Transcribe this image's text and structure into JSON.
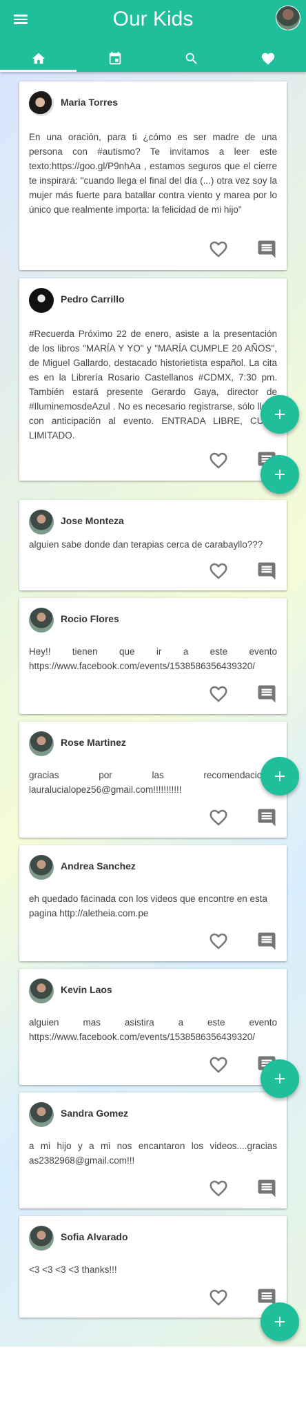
{
  "app": {
    "title": "Our Kids"
  },
  "tabs": [
    {
      "name": "home",
      "active": true
    },
    {
      "name": "calendar",
      "active": false
    },
    {
      "name": "search",
      "active": false
    },
    {
      "name": "favorites",
      "active": false
    }
  ],
  "posts": [
    {
      "author": "Maria Torres",
      "text": "En una oración, para ti ¿cómo es ser madre de una persona con #autismo? Te invitamos a leer este texto:https://goo.gl/P9nhAa , estamos seguros que el cierre te inspirará: \"cuando llega el final del día (...) otra vez soy la mujer más fuerte para batallar contra viento y marea por lo único que realmente importa: la felicidad de mi hijo\""
    },
    {
      "author": "Pedro Carrillo",
      "text": "#Recuerda Próximo 22 de enero, asiste a la presentación de los libros \"MARÍA Y YO\" y \"MARÍA CUMPLE 20 AÑOS\", de Miguel Gallardo, destacado historietista español. La cita es en la Librería Rosario Castellanos #CDMX, 7:30 pm. También estará presente Gerardo Gaya, director de #IluminemosdeAzul . No es necesario registrarse, sólo llega con anticipación al evento. ENTRADA LIBRE, CUPO LIMITADO."
    },
    {
      "author": "Jose Monteza",
      "text": "alguien sabe donde dan terapias cerca de carabayllo???"
    },
    {
      "author": "Rocio Flores",
      "text": "Hey!! tienen que ir a este evento https://www.facebook.com/events/1538586356439320/"
    },
    {
      "author": "Rose Martinez",
      "text": "gracias por las recomendaciones lauralucialopez56@gmail.com!!!!!!!!!!!"
    },
    {
      "author": "Andrea Sanchez",
      "text": "eh quedado facinada con los videos que encontre en esta pagina http://aletheia.com.pe"
    },
    {
      "author": "Kevin Laos",
      "text": "alguien mas asistira a este evento https://www.facebook.com/events/1538586356439320/"
    },
    {
      "author": "Sandra Gomez",
      "text": "a mi hijo y a mi nos encantaron los videos....gracias as2382968@gmail.com!!!"
    },
    {
      "author": "Sofia Alvarado",
      "text": "<3 <3 <3 <3 thanks!!!"
    }
  ],
  "colors": {
    "primary": "#1fbf9b",
    "icon": "#757575"
  }
}
